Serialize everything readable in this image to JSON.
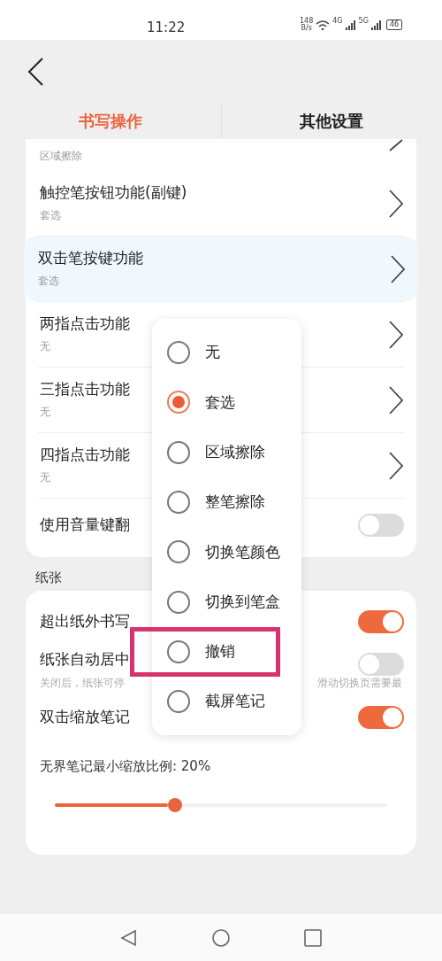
{
  "status_bar": {
    "time": "11:22",
    "speed": "148",
    "speed_unit": "B/s",
    "net_1": "4G",
    "net_2": "5G",
    "battery": "46"
  },
  "tabs": [
    {
      "label": "书写操作",
      "selected": true
    },
    {
      "label": "其他设置",
      "selected": false
    }
  ],
  "settings": {
    "partial_subtitle": "区域擦除",
    "rows": [
      {
        "kind": "nav",
        "title": "触控笔按钮功能(副键)",
        "subtitle": "套选",
        "selected": false
      },
      {
        "kind": "nav",
        "title": "双击笔按键功能",
        "subtitle": "套选",
        "selected": true
      },
      {
        "kind": "nav",
        "title": "两指点击功能",
        "subtitle": "无",
        "selected": false
      },
      {
        "kind": "nav",
        "title": "三指点击功能",
        "subtitle": "无",
        "selected": false
      },
      {
        "kind": "nav",
        "title": "四指点击功能",
        "subtitle": "无",
        "selected": false
      },
      {
        "kind": "toggle",
        "title": "使用音量键翻",
        "on": false
      }
    ]
  },
  "paper": {
    "header": "纸张",
    "rows": [
      {
        "kind": "toggle",
        "title": "超出纸外书写",
        "on": true
      },
      {
        "kind": "toggle",
        "title": "纸张自动居中",
        "hint_left": "关闭后，纸张可停",
        "hint_right": "滑动切换页需要最",
        "on": false
      },
      {
        "kind": "toggle",
        "title": "双击缩放笔记",
        "on": true
      },
      {
        "kind": "slider",
        "title": "无界笔记最小缩放比例: 20%",
        "level": 0.34
      }
    ]
  },
  "popup": {
    "options": [
      {
        "label": "无",
        "selected": false,
        "highlighted": false
      },
      {
        "label": "套选",
        "selected": true,
        "highlighted": false
      },
      {
        "label": "区域擦除",
        "selected": false,
        "highlighted": false
      },
      {
        "label": "整笔擦除",
        "selected": false,
        "highlighted": false
      },
      {
        "label": "切换笔颜色",
        "selected": false,
        "highlighted": false
      },
      {
        "label": "切换到笔盒",
        "selected": false,
        "highlighted": false
      },
      {
        "label": "撤销",
        "selected": false,
        "highlighted": true
      },
      {
        "label": "截屏笔记",
        "selected": false,
        "highlighted": false
      }
    ]
  }
}
